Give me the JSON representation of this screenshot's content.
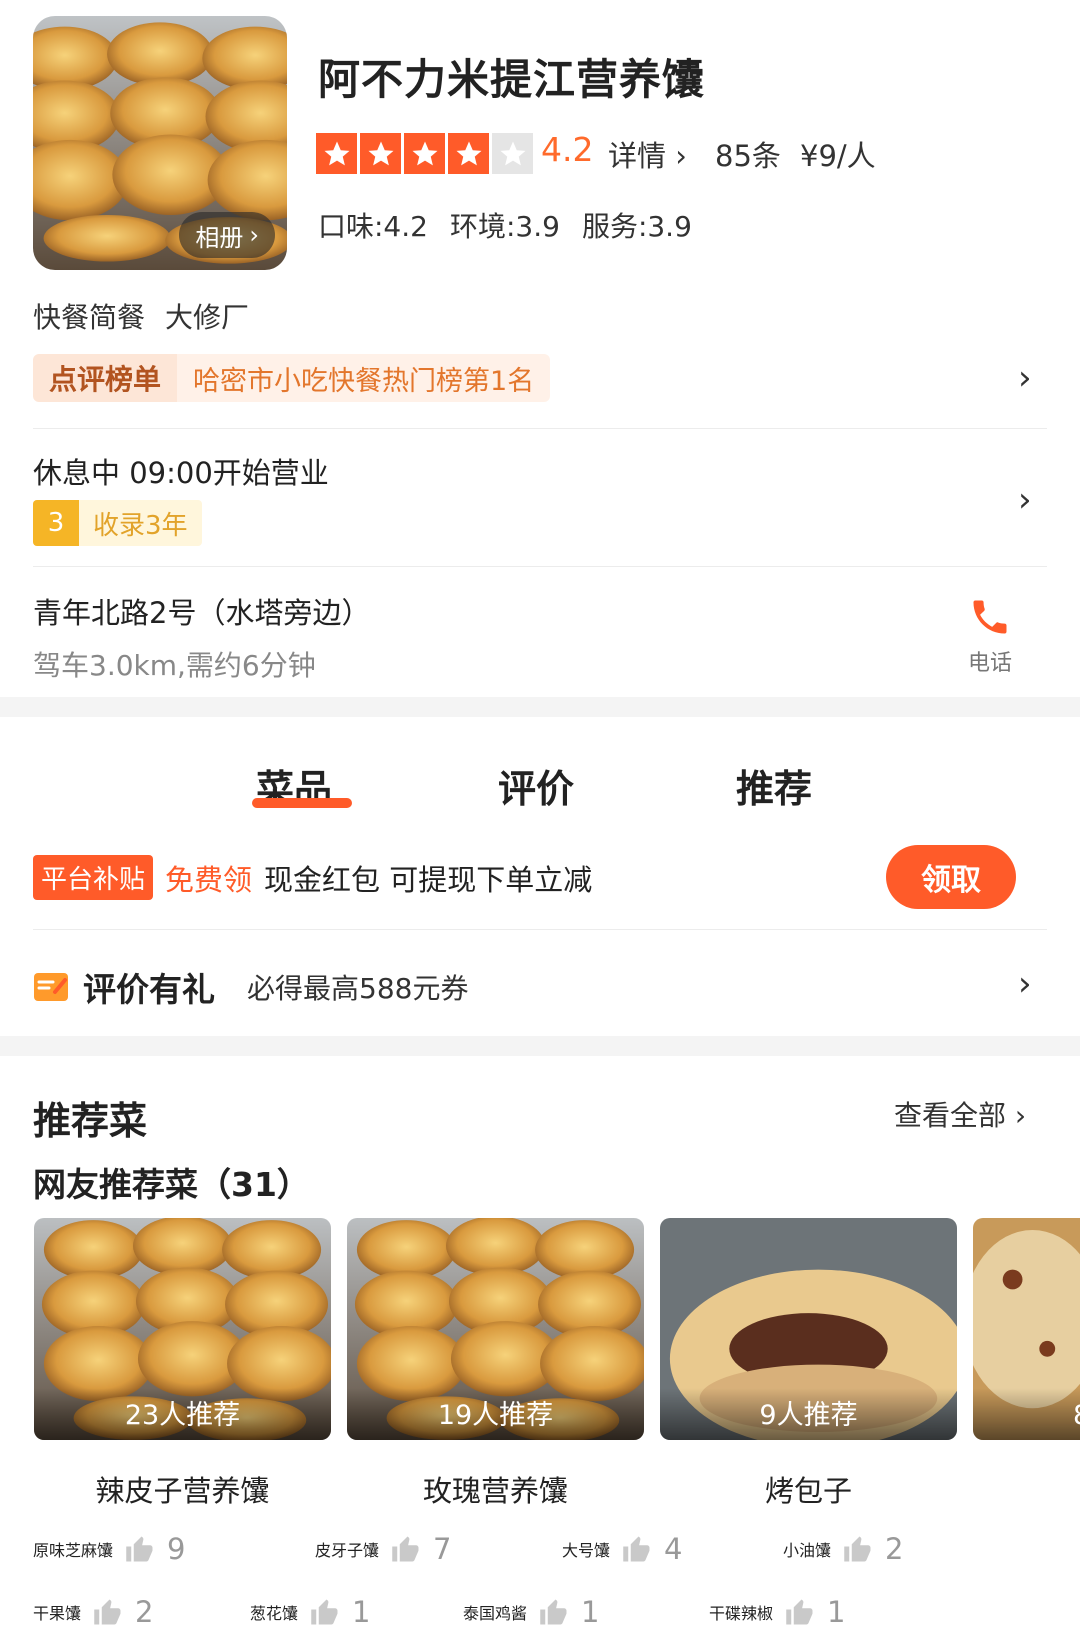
{
  "shop": {
    "name": "阿不力米提江营养馕",
    "album_label": "相册",
    "rating": "4.2",
    "stars_filled": 4,
    "stars_total": 5,
    "detail_label": "详情",
    "review_count": "85条",
    "price_per_person": "¥9/人",
    "scores": [
      "口味:4.2",
      "环境:3.9",
      "服务:3.9"
    ],
    "categories": [
      "快餐简餐",
      "大修厂"
    ],
    "rank_tag": "点评榜单",
    "rank_text": "哈密市小吃快餐热门榜第1名",
    "hours": "休息中  09:00开始营业",
    "since_badge": "3",
    "since_text": "收录3年",
    "address": "青年北路2号（水塔旁边）",
    "distance": "驾车3.0km,需约6分钟",
    "phone_label": "电话"
  },
  "tabs": [
    "菜品",
    "评价",
    "推荐"
  ],
  "promo": {
    "tag": "平台补贴",
    "free": "免费领",
    "text": "现金红包 可提现下单立减",
    "button": "领取"
  },
  "gift": {
    "title": "评价有礼",
    "desc": "必得最高588元券"
  },
  "recommend": {
    "title": "推荐菜",
    "view_all": "查看全部",
    "netizen_title": "网友推荐菜（31）",
    "dishes": [
      {
        "count": "23人推荐",
        "name": "辣皮子营养馕"
      },
      {
        "count": "19人推荐",
        "name": "玫瑰营养馕"
      },
      {
        "count": "9人推荐",
        "name": "烤包子"
      },
      {
        "count": "8",
        "name": ""
      }
    ],
    "tags": [
      {
        "name": "原味芝麻馕",
        "count": "9"
      },
      {
        "name": "皮牙子馕",
        "count": "7"
      },
      {
        "name": "大号馕",
        "count": "4"
      },
      {
        "name": "小油馕",
        "count": "2"
      },
      {
        "name": "干果馕",
        "count": "2"
      },
      {
        "name": "葱花馕",
        "count": "1"
      },
      {
        "name": "泰国鸡酱",
        "count": "1"
      },
      {
        "name": "干碟辣椒",
        "count": "1"
      }
    ]
  },
  "colors": {
    "accent": "#ff5b29",
    "gold": "#f5b526"
  },
  "icons": [
    "chevron-right-icon",
    "phone-icon",
    "star-icon",
    "gift-icon",
    "thumb-up-icon"
  ]
}
